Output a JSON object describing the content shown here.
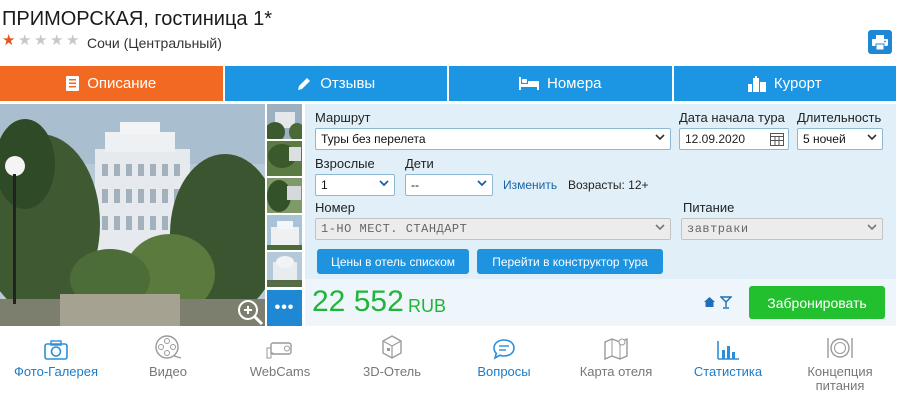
{
  "header": {
    "title": "ПРИМОРСКАЯ, гостиница 1*",
    "stars_filled": 1,
    "stars_total": 5,
    "location": "Сочи (Центральный)",
    "print_icon": "printer-icon"
  },
  "tabs": [
    {
      "label": "Описание",
      "icon": "document-icon",
      "active": true
    },
    {
      "label": "Отзывы",
      "icon": "pencil-icon",
      "active": false
    },
    {
      "label": "Номера",
      "icon": "bed-icon",
      "active": false
    },
    {
      "label": "Курорт",
      "icon": "buildings-icon",
      "active": false
    }
  ],
  "form": {
    "route_label": "Маршрут",
    "route_value": "Туры без перелета",
    "start_label": "Дата начала тура",
    "start_value": "12.09.2020",
    "duration_label": "Длительность",
    "duration_value": "5 ночей",
    "adults_label": "Взрослые",
    "adults_value": "1",
    "children_label": "Дети",
    "children_value": "--",
    "change_link": "Изменить",
    "ages_text": "Возрасты: 12+",
    "room_label": "Номер",
    "room_value": "1-НО МЕСТ. СТАНДАРТ",
    "meal_label": "Питание",
    "meal_value": "завтраки",
    "prices_list_button": "Цены в отель списком",
    "constructor_button": "Перейти в конструктор тура"
  },
  "price": {
    "amount": "22 552",
    "currency": "RUB",
    "book_button": "Забронировать"
  },
  "gallery": {
    "more_label": "•••",
    "thumbnail_count": 5
  },
  "bottom_nav": [
    {
      "label": "Фото-Галерея",
      "icon": "camera-icon",
      "blue": true
    },
    {
      "label": "Видео",
      "icon": "film-reel-icon",
      "blue": false
    },
    {
      "label": "WebCams",
      "icon": "webcam-icon",
      "blue": false
    },
    {
      "label": "3D-Отель",
      "icon": "cube-3d-icon",
      "blue": false
    },
    {
      "label": "Вопросы",
      "icon": "chat-bubble-icon",
      "blue": true
    },
    {
      "label": "Карта отеля",
      "icon": "map-icon",
      "blue": false
    },
    {
      "label": "Статистика",
      "icon": "bar-chart-icon",
      "blue": true
    },
    {
      "label": "Концепция питания",
      "icon": "dining-plate-icon",
      "blue": false
    }
  ],
  "colors": {
    "tab_active": "#f26a21",
    "tab": "#1c95e3",
    "price": "#20b53a",
    "book": "#22c02e",
    "panel": "#e1f0f8"
  }
}
